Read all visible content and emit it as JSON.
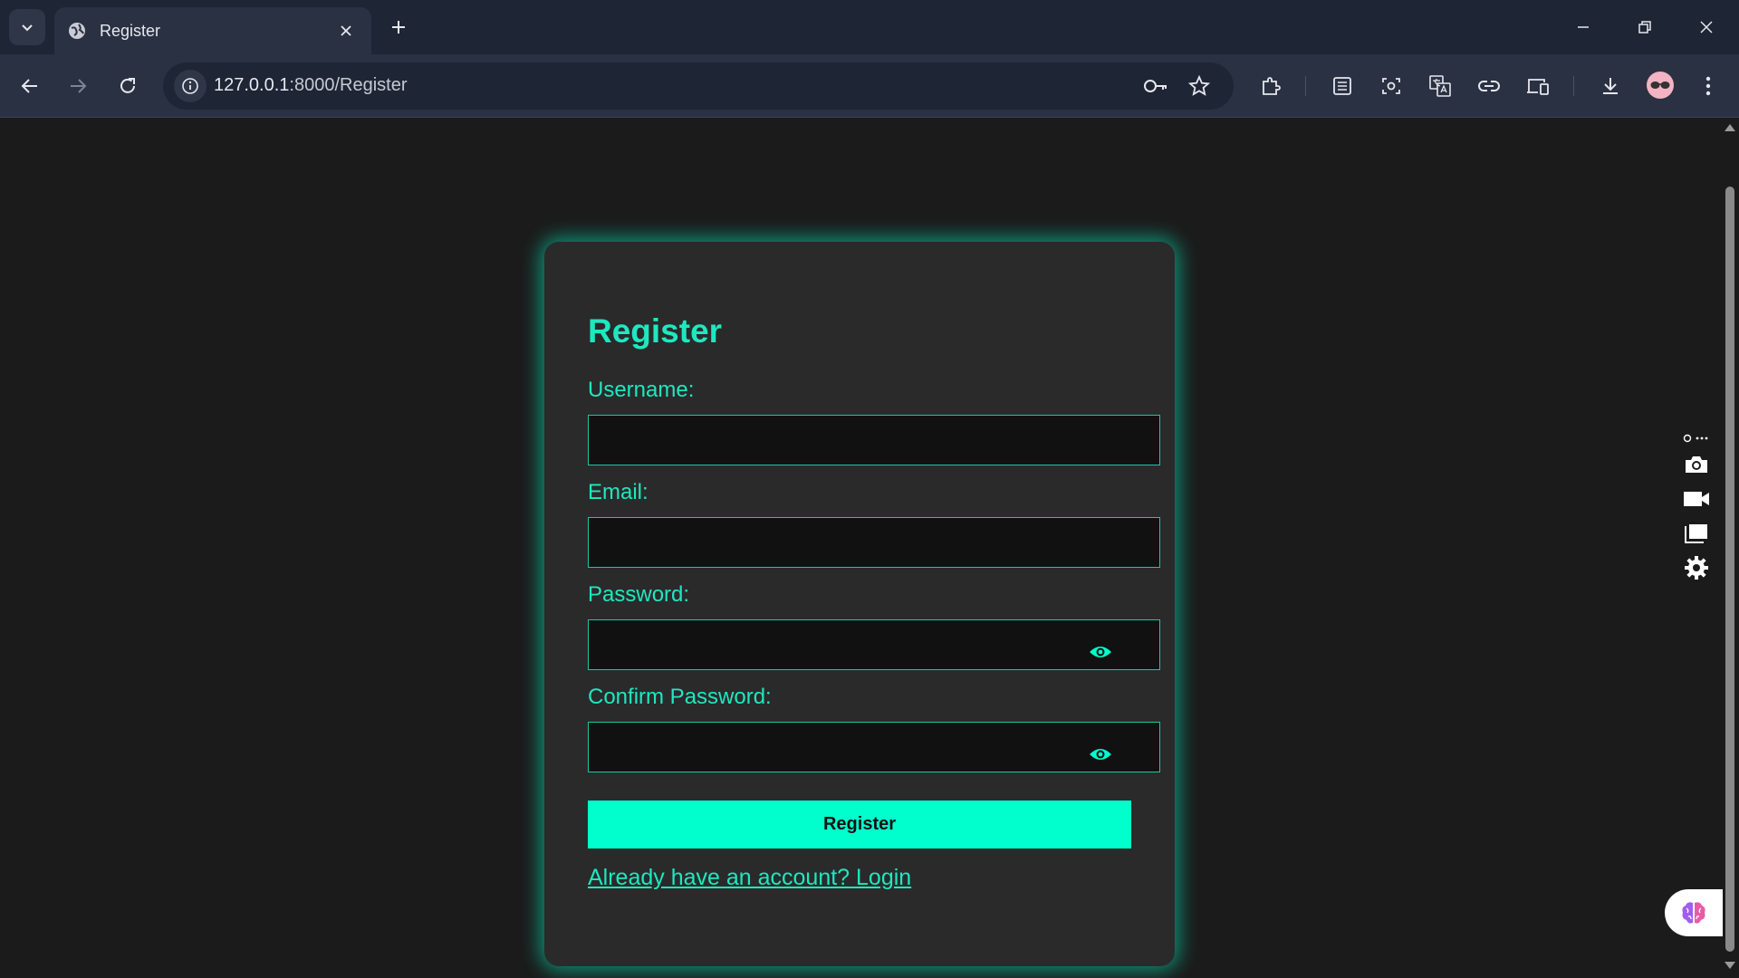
{
  "browser": {
    "tab_title": "Register",
    "url_host": "127.0.0.1",
    "url_path": ":8000/Register"
  },
  "form": {
    "title": "Register",
    "fields": [
      {
        "label": "Username:",
        "value": ""
      },
      {
        "label": "Email:",
        "value": ""
      },
      {
        "label": "Password:",
        "value": ""
      },
      {
        "label": "Confirm Password:",
        "value": ""
      }
    ],
    "submit_label": "Register",
    "login_link": "Already have an account? Login"
  },
  "colors": {
    "accent": "#00ffcc",
    "card_bg": "#2a2a2a",
    "page_bg": "#1b1b1b",
    "chrome_bg": "#1e2535"
  },
  "icons": {
    "password_toggle": "eye-icon",
    "side_tools": [
      "screenshot-camera-icon",
      "video-record-icon",
      "windows-icon",
      "gear-icon"
    ],
    "assistant": "brain-icon"
  }
}
